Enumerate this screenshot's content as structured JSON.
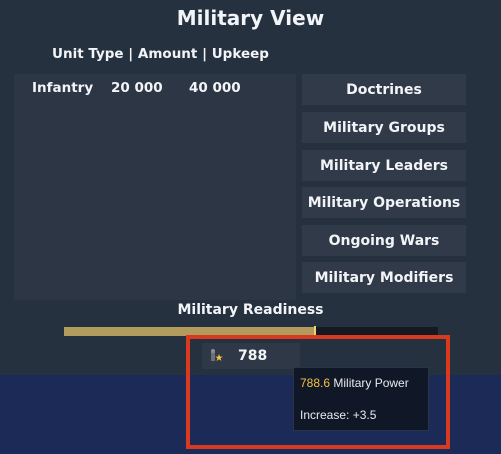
{
  "window": {
    "title": "Military View"
  },
  "table": {
    "header": "Unit Type | Amount | Upkeep",
    "rows": [
      {
        "unit_type": "Infantry",
        "amount": "20 000",
        "upkeep": "40 000"
      }
    ]
  },
  "menu": {
    "items": [
      {
        "label": "Doctrines"
      },
      {
        "label": "Military Groups"
      },
      {
        "label": "Military Leaders"
      },
      {
        "label": "Military Operations"
      },
      {
        "label": "Ongoing Wars"
      },
      {
        "label": "Military Modifiers"
      }
    ]
  },
  "readiness": {
    "label": "Military Readiness",
    "fraction": 0.67
  },
  "power": {
    "icon": "soldier-star-icon",
    "value": "788"
  },
  "tooltip": {
    "value": "788.6",
    "label": "Military Power",
    "increase": "Increase: +3.5"
  },
  "colors": {
    "panel": "#263140",
    "bar_fill": "#b39a5d",
    "highlight": "#d9391f",
    "tooltip_value": "#f2c344"
  }
}
